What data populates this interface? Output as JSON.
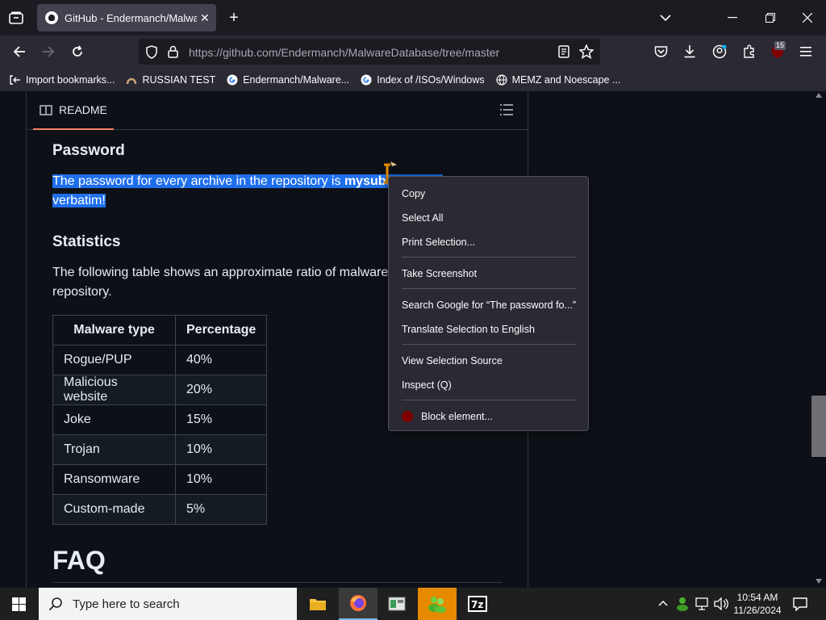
{
  "browser": {
    "tab_title": "GitHub - Endermanch/Malware",
    "url_host": "https://github.com",
    "url_path": "/Endermanch/MalwareDatabase/tree/master",
    "extension_badge": "15",
    "bookmarks": [
      {
        "label": "Import bookmarks..."
      },
      {
        "label": "RUSSIAN TEST"
      },
      {
        "label": "Endermanch/Malware..."
      },
      {
        "label": "Index of /ISOs/Windows"
      },
      {
        "label": "MEMZ and Noescape ..."
      }
    ]
  },
  "readme": {
    "tab_label": "README",
    "password_heading": "Password",
    "password_line1_pre": "The password for every archive in the repository is ",
    "password_line1_bold": "mysubs",
    "password_line2": "verbatim!",
    "statistics_heading": "Statistics",
    "stats_line1": "The following table shows an approximate ratio of malware",
    "stats_line2": "repository.",
    "table": {
      "headers": [
        "Malware type",
        "Percentage"
      ],
      "rows": [
        [
          "Rogue/PUP",
          "40%"
        ],
        [
          "Malicious website",
          "20%"
        ],
        [
          "Joke",
          "15%"
        ],
        [
          "Trojan",
          "10%"
        ],
        [
          "Ransomware",
          "10%"
        ],
        [
          "Custom-made",
          "5%"
        ]
      ]
    },
    "faq_heading": "FAQ"
  },
  "context_menu": {
    "copy": "Copy",
    "select_all": "Select All",
    "print_selection": "Print Selection...",
    "take_screenshot": "Take Screenshot",
    "search_google": "Search Google for “The password fo...”",
    "translate": "Translate Selection to English",
    "view_source": "View Selection Source",
    "inspect": "Inspect (Q)",
    "block_element": "Block element..."
  },
  "taskbar": {
    "search_placeholder": "Type here to search",
    "time": "10:54 AM",
    "date": "11/26/2024"
  },
  "colors": {
    "selection": "#1f6feb",
    "tab_underline": "#f78166",
    "taskbar_active": "#e68a00"
  }
}
